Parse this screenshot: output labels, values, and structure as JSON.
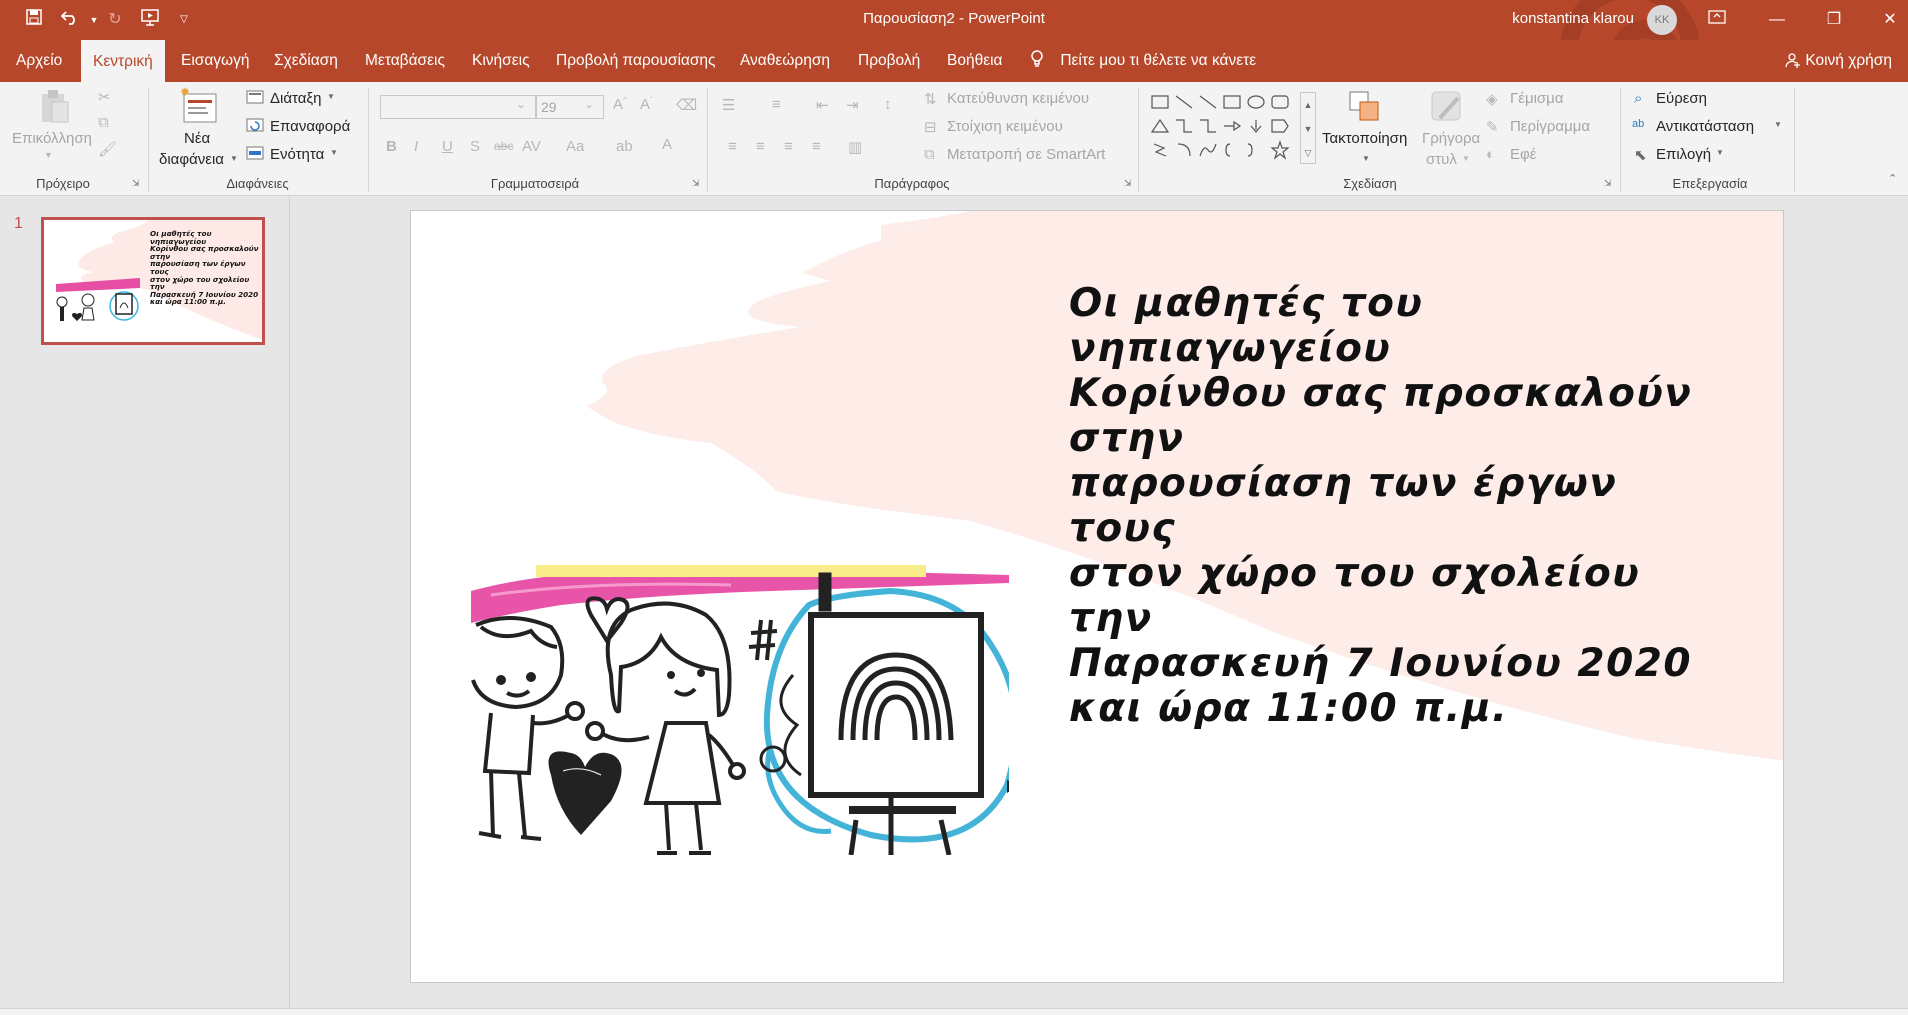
{
  "app": {
    "title": "Παρουσίαση2  -  PowerPoint",
    "user_name": "konstantina klarou",
    "user_initials": "KK",
    "accent_color": "#b7472a"
  },
  "qat": {
    "icons": [
      "save-icon",
      "undo-icon",
      "redo-icon",
      "start-from-beginning-icon",
      "customize-qat-icon"
    ]
  },
  "tabs": [
    {
      "label": "Αρχείο"
    },
    {
      "label": "Κεντρική"
    },
    {
      "label": "Εισαγωγή"
    },
    {
      "label": "Σχεδίαση"
    },
    {
      "label": "Μεταβάσεις"
    },
    {
      "label": "Κινήσεις"
    },
    {
      "label": "Προβολή παρουσίασης"
    },
    {
      "label": "Αναθεώρηση"
    },
    {
      "label": "Προβολή"
    },
    {
      "label": "Βοήθεια"
    }
  ],
  "active_tab": "Κεντρική",
  "tell_me": "Πείτε μου τι θέλετε να κάνετε",
  "share": "Κοινή χρήση",
  "ribbon": {
    "clipboard": {
      "label": "Πρόχειρο",
      "paste": "Επικόλληση"
    },
    "slides": {
      "label": "Διαφάνειες",
      "new_slide_1": "Νέα",
      "new_slide_2": "διαφάνεια",
      "layout": "Διάταξη",
      "reset": "Επαναφορά",
      "section": "Ενότητα"
    },
    "font": {
      "label": "Γραμματοσειρά",
      "font_size": "29"
    },
    "paragraph": {
      "label": "Παράγραφος",
      "text_direction": "Κατεύθυνση κειμένου",
      "align_text": "Στοίχιση κειμένου",
      "smartart": "Μετατροπή σε SmartArt"
    },
    "drawing": {
      "label": "Σχεδίαση",
      "arrange": "Τακτοποίηση",
      "quick_styles_1": "Γρήγορα",
      "quick_styles_2": "στυλ",
      "fill": "Γέμισμα",
      "outline": "Περίγραμμα",
      "effects": "Εφέ"
    },
    "editing": {
      "label": "Επεξεργασία",
      "find": "Εύρεση",
      "replace": "Αντικατάσταση",
      "select": "Επιλογή"
    }
  },
  "thumbnails": [
    {
      "number": "1"
    }
  ],
  "slide": {
    "lines": [
      "Οι μαθητές του νηπιαγωγείου",
      "Κορίνθου σας προσκαλούν στην",
      "παρουσίαση των έργων τους",
      "στον χώρο του σχολείου την",
      "Παρασκευή 7 Ιουνίου 2020",
      "και ώρα 11:00 π.μ."
    ]
  }
}
